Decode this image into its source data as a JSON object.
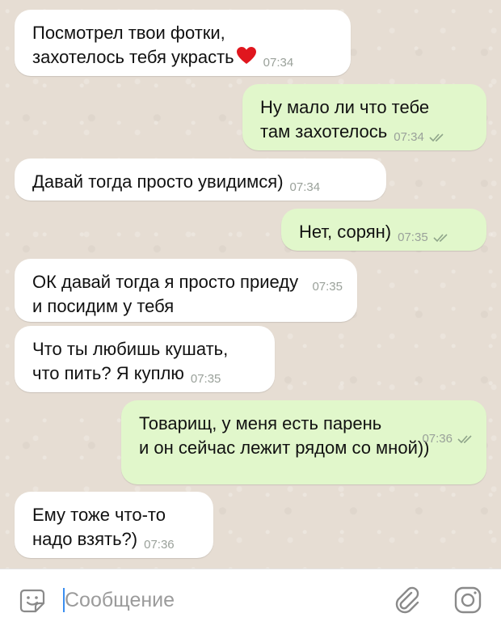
{
  "messages": [
    {
      "dir": "in",
      "text": "Посмотрел твои фотки,\nзахотелось тебя украсть",
      "time": "07:34",
      "heart": true
    },
    {
      "dir": "out",
      "text": "Ну мало ли что тебе\nтам захотелось",
      "time": "07:34",
      "read": true
    },
    {
      "dir": "in",
      "text": "Давай тогда просто увидимся)",
      "time": "07:34"
    },
    {
      "dir": "out",
      "text": "Нет, сорян)",
      "time": "07:35",
      "read": true
    },
    {
      "dir": "in",
      "text": "ОК давай тогда я просто приеду\nи посидим у тебя",
      "time": "07:35"
    },
    {
      "dir": "in",
      "text": "Что ты любишь кушать,\nчто пить? Я куплю",
      "time": "07:35"
    },
    {
      "dir": "out",
      "text": "Товарищ, у меня есть парень\nи он сейчас лежит рядом со мной))",
      "time": "07:36",
      "read": true
    },
    {
      "dir": "in",
      "text": "Ему тоже что-то\nнадо взять?)",
      "time": "07:36"
    }
  ],
  "composer": {
    "placeholder": "Сообщение"
  },
  "icons": {
    "emoji": "smile-icon",
    "attach": "paperclip-icon",
    "camera": "camera-icon",
    "read_receipt": "double-check-icon",
    "heart": "heart-emoji"
  },
  "colors": {
    "incoming_bubble": "#ffffff",
    "outgoing_bubble": "#e1f7cb",
    "read_ticks": "#8fa58a",
    "time_text": "#9aa19a"
  }
}
